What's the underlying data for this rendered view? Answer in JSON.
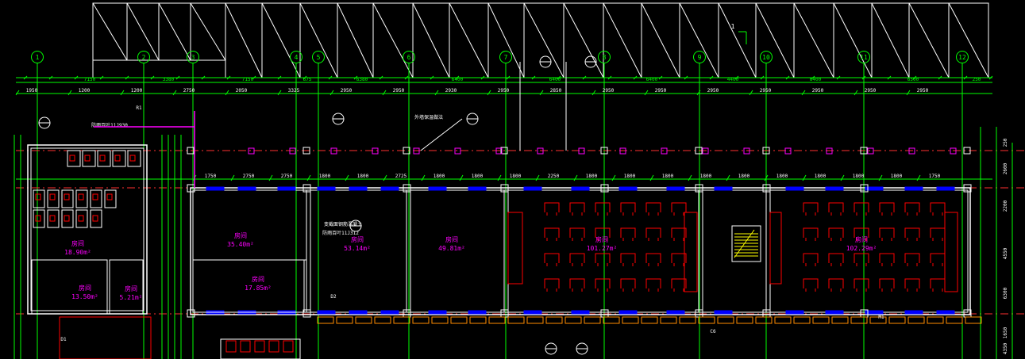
{
  "axes": [
    "1",
    "2",
    "3",
    "4",
    "5",
    "6",
    "7",
    "8",
    "9",
    "10",
    "11",
    "12"
  ],
  "top_dims": [
    "7150",
    "3380",
    "7150",
    "675",
    "6380",
    "6400",
    "6400",
    "6400",
    "4400",
    "6400",
    "6500",
    "250"
  ],
  "sub_dims": [
    "1950",
    "1200",
    "1200",
    "2750",
    "2050",
    "3325",
    "2950",
    "2950",
    "2930",
    "2950",
    "2850",
    "2950",
    "2950",
    "2950",
    "2950",
    "2950",
    "2950",
    "2950"
  ],
  "wall_dims": [
    "1750",
    "2750",
    "2750",
    "1800",
    "1800",
    "2725",
    "1800",
    "1800",
    "1800",
    "2250",
    "1800",
    "1800",
    "1800",
    "1800",
    "1800",
    "1800",
    "1800",
    "1800",
    "1800",
    "1750"
  ],
  "rooms": [
    {
      "name": "房间",
      "area": "35.40m²"
    },
    {
      "name": "房间",
      "area": "53.14m²"
    },
    {
      "name": "房间",
      "area": "49.81m²"
    },
    {
      "name": "房间",
      "area": "101.27m²"
    },
    {
      "name": "房间",
      "area": "102.29m²"
    },
    {
      "name": "房间",
      "area": "17.85m²"
    },
    {
      "name": "房间",
      "area": "18.90m²"
    },
    {
      "name": "房间",
      "area": "5.21m²"
    },
    {
      "name": "房间",
      "area": "13.50m²"
    }
  ],
  "notes": [
    "变截面钢筋混凝土",
    "防雨百叶11J312",
    "防雨百叶11J930",
    "外墙保温做法",
    "R1",
    "C6",
    "D1",
    "D2",
    "M1"
  ],
  "vertical_dims": [
    "2600",
    "2200",
    "4550",
    "6300",
    "1650",
    "4350",
    "250"
  ],
  "colors": {
    "bg": "#000000",
    "axis": "#00ff00",
    "wall": "#ffffff",
    "window": "#0000ff",
    "furniture": "#ff0000",
    "text": "#ff00ff",
    "dim": "#00ff00",
    "hatch": "#ffffff",
    "stair": "#ffff00"
  }
}
